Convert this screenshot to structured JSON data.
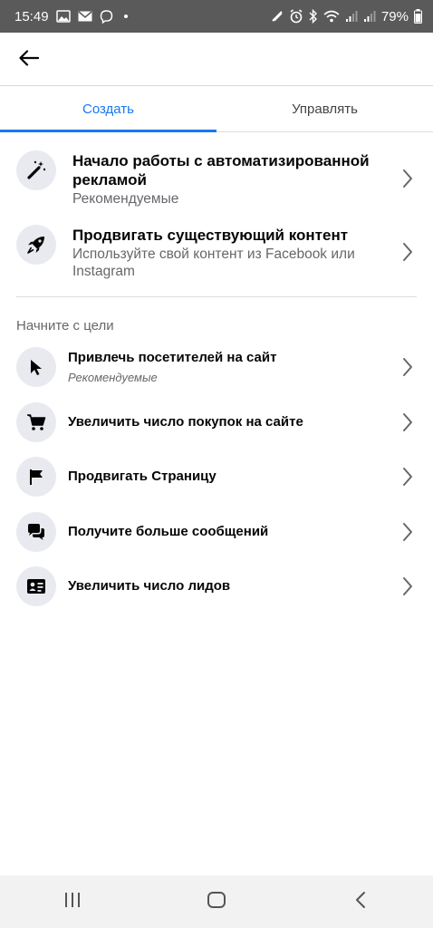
{
  "status_bar": {
    "time": "15:49",
    "battery": "79%",
    "left_icons": [
      "image-icon",
      "mail-icon",
      "viber-icon"
    ],
    "right_icons": [
      "nfc-icon",
      "alarm-icon",
      "bluetooth-icon",
      "wifi-icon",
      "signal-icon",
      "signal-icon"
    ]
  },
  "header": {
    "back_icon": "arrow-left-icon"
  },
  "tabs": [
    {
      "label": "Создать",
      "active": true
    },
    {
      "label": "Управлять",
      "active": false
    }
  ],
  "main_options": [
    {
      "title": "Начало работы с автоматизированной рекламой",
      "subtitle": "Рекомендуемые",
      "icon": "magic-wand-icon"
    },
    {
      "title": "Продвигать существующий контент",
      "subtitle": "Используйте свой контент из Facebook или Instagram",
      "icon": "rocket-icon"
    }
  ],
  "goals": {
    "section_label": "Начните с цели",
    "items": [
      {
        "title": "Привлечь посетителей на сайт",
        "subtitle": "Рекомендуемые",
        "icon": "cursor-icon"
      },
      {
        "title": "Увеличить число покупок на сайте",
        "icon": "cart-icon"
      },
      {
        "title": "Продвигать Страницу",
        "icon": "flag-icon"
      },
      {
        "title": "Получите больше сообщений",
        "icon": "chat-bubbles-icon"
      },
      {
        "title": "Увеличить число лидов",
        "icon": "contact-card-icon"
      }
    ]
  },
  "nav_bar": {
    "icons": [
      "recent-apps-icon",
      "home-icon",
      "back-icon"
    ]
  },
  "colors": {
    "accent": "#1877f2",
    "status_bar": "#5a5a5a",
    "icon_bg": "#e8eaef"
  }
}
